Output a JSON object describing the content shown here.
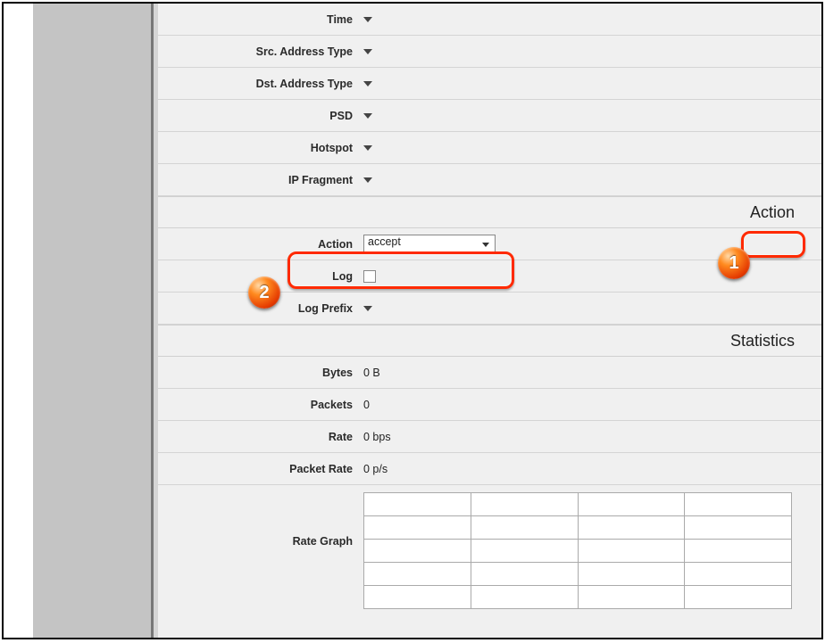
{
  "fields": {
    "time": "Time",
    "src_addr_type": "Src. Address Type",
    "dst_addr_type": "Dst. Address Type",
    "psd": "PSD",
    "hotspot": "Hotspot",
    "ip_fragment": "IP Fragment",
    "action": "Action",
    "log": "Log",
    "log_prefix": "Log Prefix",
    "bytes": "Bytes",
    "packets": "Packets",
    "rate": "Rate",
    "packet_rate": "Packet Rate",
    "rate_graph": "Rate Graph"
  },
  "values": {
    "action_select": "accept",
    "bytes": "0 B",
    "packets": "0",
    "rate": "0 bps",
    "packet_rate": "0 p/s"
  },
  "sections": {
    "action": "Action",
    "statistics": "Statistics"
  },
  "markers": {
    "one": "1",
    "two": "2"
  }
}
